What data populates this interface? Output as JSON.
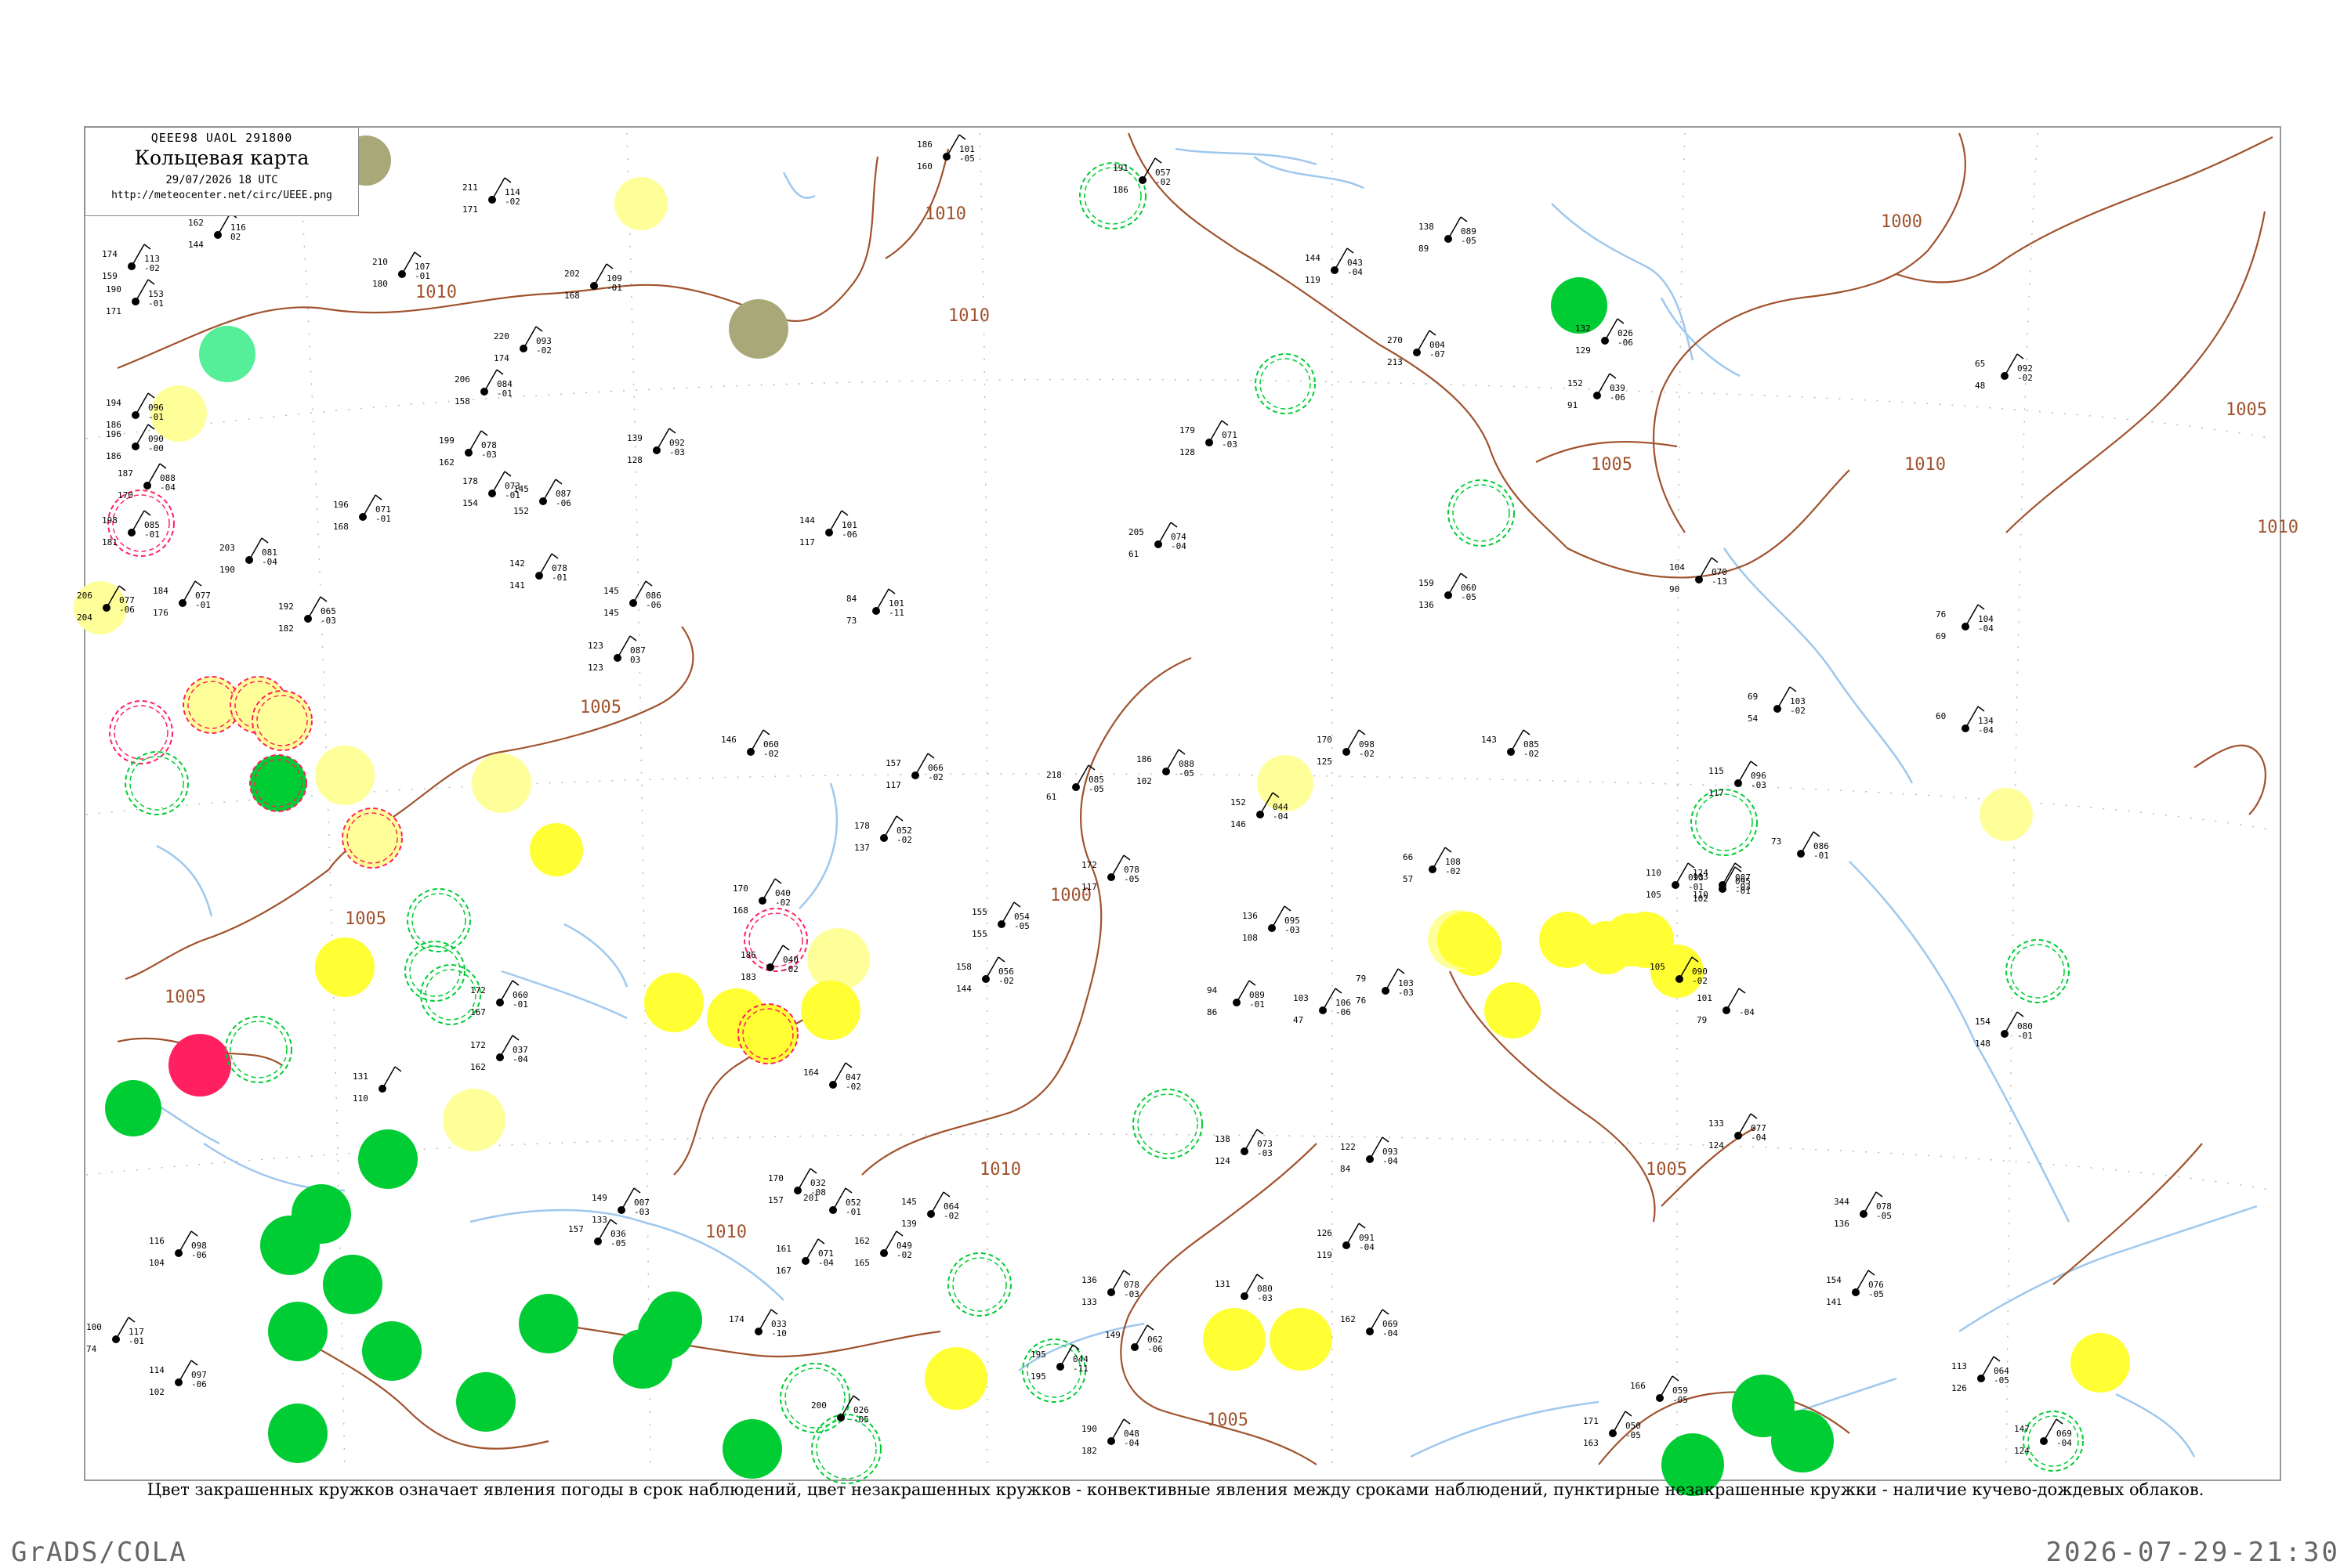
{
  "header": {
    "code": "QEEE98  UAOL  291800",
    "title": "Кольцевая карта",
    "time": "29/07/2026 18 UTC",
    "url": "http://meteocenter.net/circ/UEEE.png"
  },
  "isobars": [
    "1010",
    "1010",
    "1010",
    "1005",
    "1005",
    "1005",
    "1000",
    "1005",
    "1010",
    "1005",
    "1010",
    "1000",
    "1010",
    "1005",
    "1005",
    "1010"
  ],
  "colors": {
    "isobar": "#a0522d",
    "water": "#9ec8ee",
    "heavy": "#00cc33",
    "yellow": "#ffff33",
    "pale_yellow": "#ffff99",
    "olive": "#a8a878",
    "red": "#ff2060",
    "mint": "#55ee99"
  },
  "stations": [
    {
      "t": "206",
      "d": "204",
      "p": "077",
      "c": "-06"
    },
    {
      "t": "174",
      "d": "159",
      "p": "113",
      "c": "-02"
    },
    {
      "t": "190",
      "d": "171",
      "p": "153",
      "c": "-01"
    },
    {
      "t": "194",
      "d": "186",
      "p": "096",
      "c": "-01"
    },
    {
      "t": "196",
      "d": "186",
      "p": "090",
      "c": "-00"
    },
    {
      "t": "187",
      "d": "170",
      "p": "088",
      "c": "-04"
    },
    {
      "t": "198",
      "d": "181",
      "p": "085",
      "c": "-01"
    },
    {
      "t": "162",
      "d": "144",
      "p": "116",
      "c": "02"
    },
    {
      "t": "211",
      "d": "171",
      "p": "114",
      "c": "-02"
    },
    {
      "t": "210",
      "d": "180",
      "p": "107",
      "c": "-01"
    },
    {
      "t": "202",
      "d": "168",
      "p": "109",
      "c": "-01"
    },
    {
      "t": "220",
      "d": "174",
      "p": "093",
      "c": "-02"
    },
    {
      "t": "206",
      "d": "158",
      "p": "084",
      "c": "-01"
    },
    {
      "t": "199",
      "d": "162",
      "p": "078",
      "c": "-03"
    },
    {
      "t": "178",
      "d": "154",
      "p": "073",
      "c": "-01"
    },
    {
      "t": "145",
      "d": "152",
      "p": "087",
      "c": "-06"
    },
    {
      "t": "196",
      "d": "168",
      "p": "071",
      "c": "-01"
    },
    {
      "t": "203",
      "d": "190",
      "p": "081",
      "c": "-04"
    },
    {
      "t": "184",
      "d": "176",
      "p": "077",
      "c": "-01"
    },
    {
      "t": "192",
      "d": "182",
      "p": "065",
      "c": "-03"
    },
    {
      "t": "139",
      "d": "128",
      "p": "092",
      "c": "-03"
    },
    {
      "t": "145",
      "d": "145",
      "p": "086",
      "c": "-06"
    },
    {
      "t": "123",
      "d": "123",
      "p": "087",
      "c": "03"
    },
    {
      "t": "142",
      "d": "141",
      "p": "078",
      "c": "-01"
    },
    {
      "t": "144",
      "d": "117",
      "p": "101",
      "c": "-06"
    },
    {
      "t": "84",
      "d": "73",
      "p": "101",
      "c": "-11"
    },
    {
      "t": "186",
      "d": "160",
      "p": "101",
      "c": "-05"
    },
    {
      "t": "191",
      "d": "186",
      "p": "057",
      "c": "-02"
    },
    {
      "t": "146",
      "d": "",
      "p": "060",
      "c": "-02"
    },
    {
      "t": "157",
      "d": "117",
      "p": "066",
      "c": "-02"
    },
    {
      "t": "178",
      "d": "137",
      "p": "052",
      "c": "-02"
    },
    {
      "t": "218",
      "d": "61",
      "p": "085",
      "c": "-05"
    },
    {
      "t": "186",
      "d": "102",
      "p": "088",
      "c": "-05"
    },
    {
      "t": "179",
      "d": "128",
      "p": "071",
      "c": "-03"
    },
    {
      "t": "205",
      "d": "61",
      "p": "074",
      "c": "-04"
    },
    {
      "t": "144",
      "d": "119",
      "p": "043",
      "c": "-04"
    },
    {
      "t": "270",
      "d": "213",
      "p": "004",
      "c": "-07"
    },
    {
      "t": "138",
      "d": "89",
      "p": "089",
      "c": "-05"
    },
    {
      "t": "152",
      "d": "146",
      "p": "044",
      "c": "-04"
    },
    {
      "t": "170",
      "d": "125",
      "p": "098",
      "c": "-02"
    },
    {
      "t": "143",
      "d": "",
      "p": "085",
      "c": "-02"
    },
    {
      "t": "159",
      "d": "136",
      "p": "060",
      "c": "-05"
    },
    {
      "t": "104",
      "d": "90",
      "p": "070",
      "c": "-13"
    },
    {
      "t": "76",
      "d": "69",
      "p": "104",
      "c": "-04"
    },
    {
      "t": "69",
      "d": "54",
      "p": "103",
      "c": "-02"
    },
    {
      "t": "60",
      "d": "",
      "p": "134",
      "c": "-04"
    },
    {
      "t": "65",
      "d": "48",
      "p": "092",
      "c": "-02"
    },
    {
      "t": "152",
      "d": "91",
      "p": "039",
      "c": "-06"
    },
    {
      "t": "132",
      "d": "129",
      "p": "026",
      "c": "-06"
    },
    {
      "t": "115",
      "d": "117",
      "p": "096",
      "c": "-03"
    },
    {
      "t": "103",
      "d": "102",
      "p": "095",
      "c": "-01"
    },
    {
      "t": "124",
      "d": "110",
      "p": "087",
      "c": "-03"
    },
    {
      "t": "110",
      "d": "105",
      "p": "093",
      "c": "-01"
    },
    {
      "t": "73",
      "d": "",
      "p": "086",
      "c": "-01"
    },
    {
      "t": "66",
      "d": "57",
      "p": "108",
      "c": "-02"
    },
    {
      "t": "79",
      "d": "76",
      "p": "103",
      "c": "-03"
    },
    {
      "t": "105",
      "d": "",
      "p": "090",
      "c": "-02"
    },
    {
      "t": "101",
      "d": "79",
      "p": "",
      "c": "-04"
    },
    {
      "t": "94",
      "d": "86",
      "p": "089",
      "c": "-01"
    },
    {
      "t": "103",
      "d": "47",
      "p": "106",
      "c": "-06"
    },
    {
      "t": "136",
      "d": "108",
      "p": "095",
      "c": "-03"
    },
    {
      "t": "155",
      "d": "155",
      "p": "054",
      "c": "-05"
    },
    {
      "t": "158",
      "d": "144",
      "p": "056",
      "c": "-02"
    },
    {
      "t": "172",
      "d": "117",
      "p": "078",
      "c": "-05"
    },
    {
      "t": "138",
      "d": "124",
      "p": "073",
      "c": "-03"
    },
    {
      "t": "122",
      "d": "84",
      "p": "093",
      "c": "-04"
    },
    {
      "t": "133",
      "d": "124",
      "p": "077",
      "c": "-04"
    },
    {
      "t": "154",
      "d": "148",
      "p": "080",
      "c": "-01"
    },
    {
      "t": "344",
      "d": "136",
      "p": "078",
      "c": "-05"
    },
    {
      "t": "154",
      "d": "141",
      "p": "076",
      "c": "-05"
    },
    {
      "t": "113",
      "d": "126",
      "p": "064",
      "c": "-05"
    },
    {
      "t": "147",
      "d": "124",
      "p": "069",
      "c": "-04"
    },
    {
      "t": "171",
      "d": "163",
      "p": "050",
      "c": "-05"
    },
    {
      "t": "166",
      "d": "",
      "p": "059",
      "c": "-05"
    },
    {
      "t": "126",
      "d": "119",
      "p": "091",
      "c": "-04"
    },
    {
      "t": "162",
      "d": "",
      "p": "069",
      "c": "-04"
    },
    {
      "t": "131",
      "d": "",
      "p": "080",
      "c": "-03"
    },
    {
      "t": "136",
      "d": "133",
      "p": "078",
      "c": "-03"
    },
    {
      "t": "190",
      "d": "182",
      "p": "048",
      "c": "-04"
    },
    {
      "t": "149",
      "d": "",
      "p": "062",
      "c": "-06"
    },
    {
      "t": "145",
      "d": "139",
      "p": "064",
      "c": "-02"
    },
    {
      "t": "131",
      "d": "110",
      "p": "",
      "c": ""
    },
    {
      "t": "172",
      "d": "162",
      "p": "037",
      "c": "-04"
    },
    {
      "t": "116",
      "d": "104",
      "p": "098",
      "c": "-06"
    },
    {
      "t": "100",
      "d": "74",
      "p": "117",
      "c": "-01"
    },
    {
      "t": "114",
      "d": "102",
      "p": "097",
      "c": "-06"
    },
    {
      "t": "170",
      "d": "168",
      "p": "040",
      "c": "-02"
    },
    {
      "t": "186",
      "d": "183",
      "p": "040",
      "c": "-02"
    },
    {
      "t": "172",
      "d": "167",
      "p": "060",
      "c": "-01"
    },
    {
      "t": "195",
      "d": "195",
      "p": "044",
      "c": "-11"
    },
    {
      "t": "201",
      "d": "",
      "p": "052",
      "c": "-01"
    },
    {
      "t": "162",
      "d": "165",
      "p": "049",
      "c": "-02"
    },
    {
      "t": "161",
      "d": "167",
      "p": "071",
      "c": "-04"
    },
    {
      "t": "157",
      "d": "",
      "p": "036",
      "c": "-05"
    },
    {
      "t": "149",
      "d": "133",
      "p": "007",
      "c": "-03"
    },
    {
      "t": "170",
      "d": "157",
      "p": "032",
      "c": "-08"
    },
    {
      "t": "174",
      "d": "",
      "p": "033",
      "c": "-10"
    },
    {
      "t": "164",
      "d": "",
      "p": "047",
      "c": "-02"
    },
    {
      "t": "200",
      "d": "",
      "p": "026",
      "c": "-05"
    }
  ],
  "caption": "Цвет закрашенных кружков означает явления погоды в срок наблюдений, цвет незакрашенных кружков - конвективные явления между сроками наблюдений, пунктирные незакрашенные кружки - наличие кучево-дождевых облаков.",
  "footer": {
    "left": "GrADS/COLA",
    "right": "2026-07-29-21:30"
  }
}
